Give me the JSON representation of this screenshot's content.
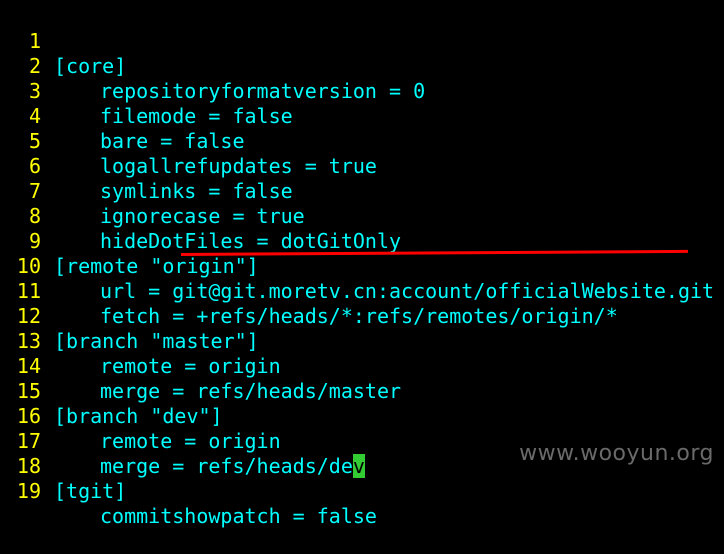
{
  "editor": {
    "lines": [
      {
        "num": "1",
        "text": "[core]"
      },
      {
        "num": "2",
        "text": "repositoryformatversion = 0"
      },
      {
        "num": "3",
        "text": "filemode = false"
      },
      {
        "num": "4",
        "text": "bare = false"
      },
      {
        "num": "5",
        "text": "logallrefupdates = true"
      },
      {
        "num": "6",
        "text": "symlinks = false"
      },
      {
        "num": "7",
        "text": "ignorecase = true"
      },
      {
        "num": "8",
        "text": "hideDotFiles = dotGitOnly"
      },
      {
        "num": "9",
        "text": "[remote \"origin\"]"
      },
      {
        "num": "10",
        "text": "url = git@git.moretv.cn:account/officialWebsite.git"
      },
      {
        "num": "11",
        "text": "fetch = +refs/heads/*:refs/remotes/origin/*"
      },
      {
        "num": "12",
        "text": "[branch \"master\"]"
      },
      {
        "num": "13",
        "text": "remote = origin"
      },
      {
        "num": "14",
        "text": "merge = refs/heads/master"
      },
      {
        "num": "15",
        "text": "[branch \"dev\"]"
      },
      {
        "num": "16",
        "text": "remote = origin"
      },
      {
        "num": "17",
        "text_before_cursor": "merge = refs/heads/de",
        "cursor_char": "v"
      },
      {
        "num": "18",
        "text": "[tgit]"
      },
      {
        "num": "19",
        "text": "commitshowpatch = false"
      }
    ]
  },
  "watermark": "www.wooyun.org",
  "colors": {
    "background": "#000000",
    "text": "#00ffff",
    "line_numbers": "#ffff00",
    "cursor": "#33cc33",
    "highlight_underline": "#ff0000"
  }
}
